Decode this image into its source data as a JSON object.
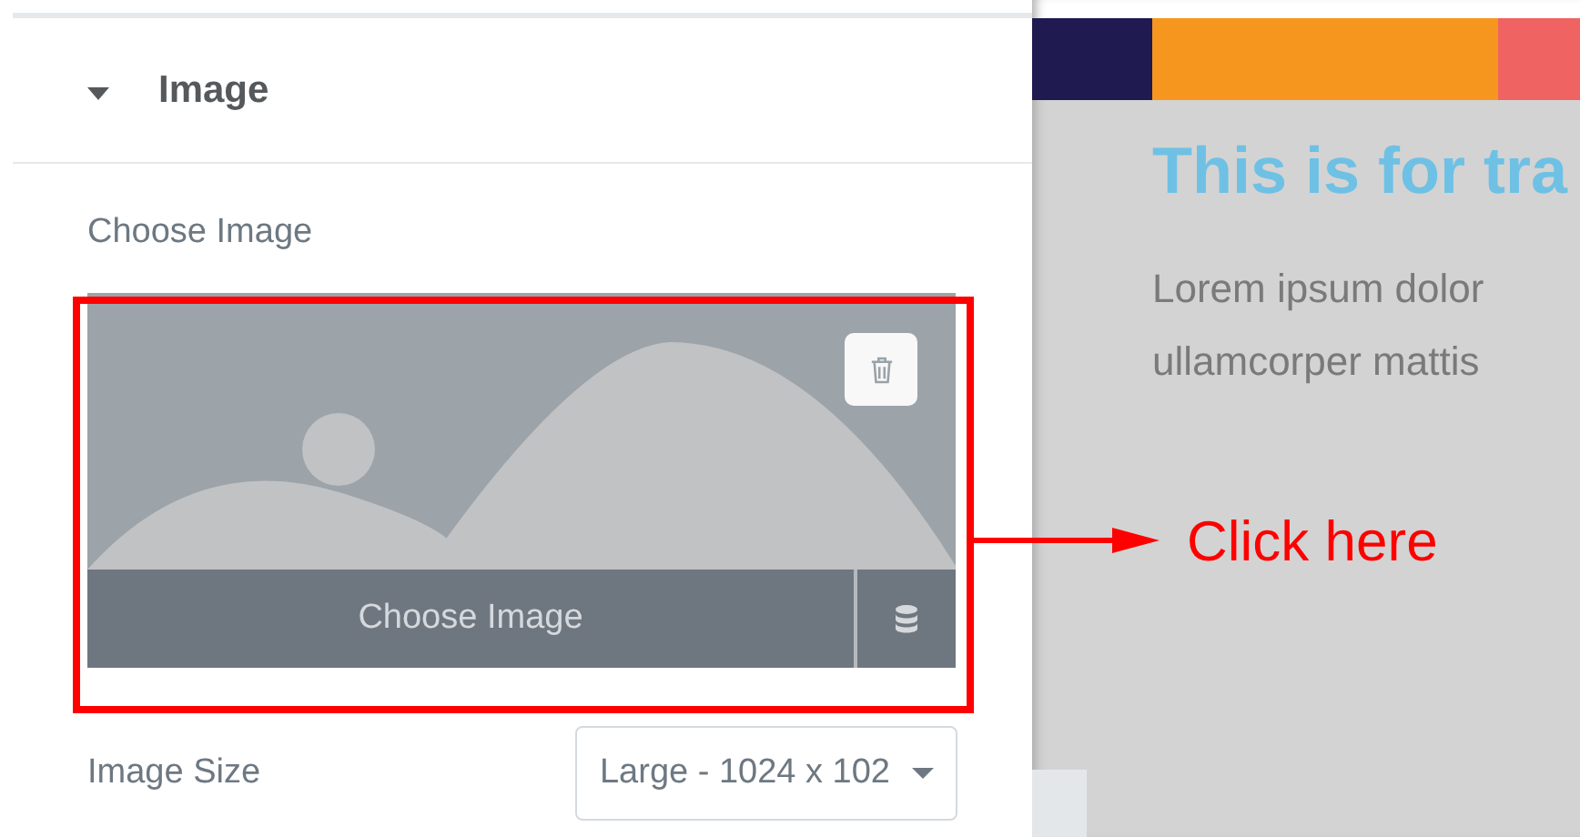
{
  "section": {
    "title": "Image",
    "expanded": true
  },
  "image_control": {
    "label": "Choose Image",
    "button": "Choose Image"
  },
  "image_size": {
    "label": "Image Size",
    "value": "Large - 1024 x 102"
  },
  "preview": {
    "color_bar": [
      {
        "color": "#1f1a4f"
      },
      {
        "color": "#f7961f"
      },
      {
        "color": "#ef6363"
      }
    ],
    "heading": "This is for tra",
    "body": [
      "Lorem ipsum dolor",
      "ullamcorper mattis"
    ]
  },
  "annotation": {
    "text": "Click here"
  }
}
